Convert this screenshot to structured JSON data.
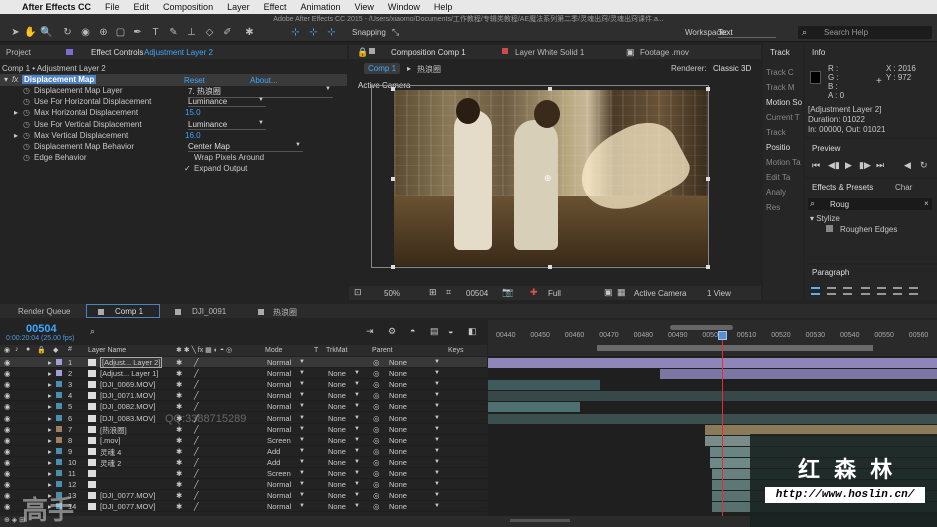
{
  "menubar": {
    "app": "After Effects CC",
    "items": [
      "File",
      "Edit",
      "Composition",
      "Layer",
      "Effect",
      "Animation",
      "View",
      "Window",
      "Help"
    ]
  },
  "window_title": "Adobe After Effects CC 2015 - /Users/xiaomo/Documents/工作教程/专辑类教程/AE魔法系列第二季/灵魂出窍/灵魂出窍课件.a...",
  "toolbar": {
    "snapping": "Snapping",
    "workspace_label": "Workspace:",
    "workspace_value": "Text",
    "search_help": "Search Help"
  },
  "left_panel": {
    "tabs": [
      "Project",
      "Effect Controls",
      "Adjustment Layer 2"
    ],
    "breadcrumb": "Comp 1 • Adjustment Layer 2",
    "effect": {
      "name": "Displacement Map",
      "reset": "Reset",
      "about": "About..."
    },
    "props": [
      {
        "label": "Displacement Map Layer",
        "value": "7. 热浪圈",
        "kind": "dropdown"
      },
      {
        "label": "Use For Horizontal Displacement",
        "value": "Luminance",
        "kind": "dropdown"
      },
      {
        "label": "Max Horizontal Displacement",
        "value": "15.0",
        "kind": "number"
      },
      {
        "label": "Use For Vertical Displacement",
        "value": "Luminance",
        "kind": "dropdown"
      },
      {
        "label": "Max Vertical Displacement",
        "value": "16.0",
        "kind": "number"
      },
      {
        "label": "Displacement Map Behavior",
        "value": "Center Map",
        "kind": "dropdown"
      },
      {
        "label": "Edge Behavior",
        "value": "Wrap Pixels Around",
        "kind": "checkbox"
      },
      {
        "label": "",
        "value": "Expand Output",
        "kind": "checkbox-checked"
      }
    ]
  },
  "viewer": {
    "tabs": [
      "Composition Comp 1",
      "Layer White Solid 1",
      "Footage .mov"
    ],
    "subtabs": [
      "Comp 1",
      "热浪圈"
    ],
    "renderer_label": "Renderer:",
    "renderer_value": "Classic 3D",
    "camera_label": "Active Camera",
    "footer": {
      "zoom": "50%",
      "timecode": "00504",
      "quality": "Full",
      "camera": "Active Camera",
      "view": "1 View"
    }
  },
  "side_panels": {
    "track_tab": "Track",
    "track_items": [
      "Track C",
      "Track M",
      "Motion So",
      "Current T",
      "Track",
      "Positio",
      "Motion Ta",
      "Edit Ta",
      "Analy",
      "Res"
    ],
    "info": {
      "tab": "Info",
      "r": "R :",
      "g": "G :",
      "b": "B :",
      "a": "A : 0",
      "x": "X : 2016",
      "y": "Y : 972",
      "layer": "[Adjustment Layer 2]",
      "duration": "Duration: 01022",
      "inout": "In: 00000, Out: 01021"
    },
    "preview_tab": "Preview",
    "effects_tabs": [
      "Effects & Presets",
      "Char"
    ],
    "search_value": "Roug",
    "tree": [
      "▾ Stylize",
      "Roughen Edges"
    ],
    "paragraph_tab": "Paragraph"
  },
  "timeline": {
    "tabs": [
      "Render Queue",
      "Comp 1",
      "DJI_0091",
      "热浪圈"
    ],
    "timecode": "00504",
    "fps": "0:00:20:04 (25.00 fps)",
    "cols": {
      "layer_name": "Layer Name",
      "mode": "Mode",
      "t": "T",
      "trkmat": "TrkMat",
      "parent": "Parent",
      "keys": "Keys"
    },
    "ruler": [
      "00440",
      "00450",
      "00460",
      "00470",
      "00480",
      "00490",
      "00500",
      "00510",
      "00520",
      "00530",
      "00540",
      "00550",
      "00560"
    ],
    "layers": [
      {
        "num": "1",
        "name": "[Adjust... Layer 2]",
        "mode": "Normal",
        "trk": "",
        "parent": "None"
      },
      {
        "num": "2",
        "name": "[Adjust... Layer 1]",
        "mode": "Normal",
        "trk": "None",
        "parent": "None"
      },
      {
        "num": "3",
        "name": "[DJI_0069.MOV]",
        "mode": "Normal",
        "trk": "None",
        "parent": "None"
      },
      {
        "num": "4",
        "name": "[DJI_0071.MOV]",
        "mode": "Normal",
        "trk": "None",
        "parent": "None"
      },
      {
        "num": "5",
        "name": "[DJI_0082.MOV]",
        "mode": "Normal",
        "trk": "None",
        "parent": "None"
      },
      {
        "num": "6",
        "name": "[DJI_0083.MOV]",
        "mode": "Normal",
        "trk": "None",
        "parent": "None"
      },
      {
        "num": "7",
        "name": "[热浪圈]",
        "mode": "Normal",
        "trk": "None",
        "parent": "None"
      },
      {
        "num": "8",
        "name": "[.mov]",
        "mode": "Screen",
        "trk": "None",
        "parent": "None"
      },
      {
        "num": "9",
        "name": "灵魂 4",
        "mode": "Add",
        "trk": "None",
        "parent": "None"
      },
      {
        "num": "10",
        "name": "灵魂 2",
        "mode": "Add",
        "trk": "None",
        "parent": "None"
      },
      {
        "num": "11",
        "name": "",
        "mode": "Screen",
        "trk": "None",
        "parent": "None"
      },
      {
        "num": "12",
        "name": "",
        "mode": "Normal",
        "trk": "None",
        "parent": "None"
      },
      {
        "num": "13",
        "name": "[DJI_0077.MOV]",
        "mode": "Normal",
        "trk": "None",
        "parent": "None"
      },
      {
        "num": "14",
        "name": "[DJI_0077.MOV]",
        "mode": "Normal",
        "trk": "None",
        "parent": "None"
      }
    ]
  },
  "watermark": {
    "title": "红 森 林",
    "url": "http://www.hoslin.cn/"
  },
  "overlay": {
    "qq": "QQ:3388715289"
  }
}
